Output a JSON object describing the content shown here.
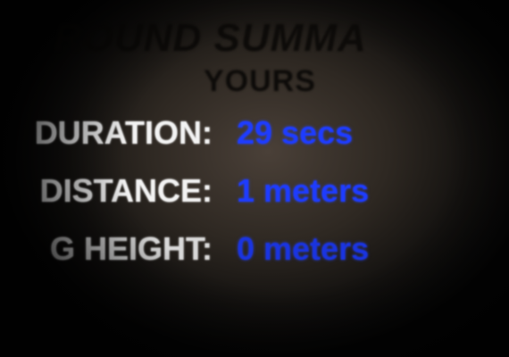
{
  "summary": {
    "title": "ROUND SUMMA",
    "subtitle": "YOURS",
    "stats": [
      {
        "label": "DURATION:",
        "value": "29 secs"
      },
      {
        "label": "DISTANCE:",
        "value": "1 meters"
      },
      {
        "label": "G HEIGHT:",
        "value": "0 meters"
      }
    ]
  },
  "colors": {
    "label_text": "#f2f2f2",
    "value_text": "#1e3cff",
    "title_text": "#0d0b09"
  }
}
